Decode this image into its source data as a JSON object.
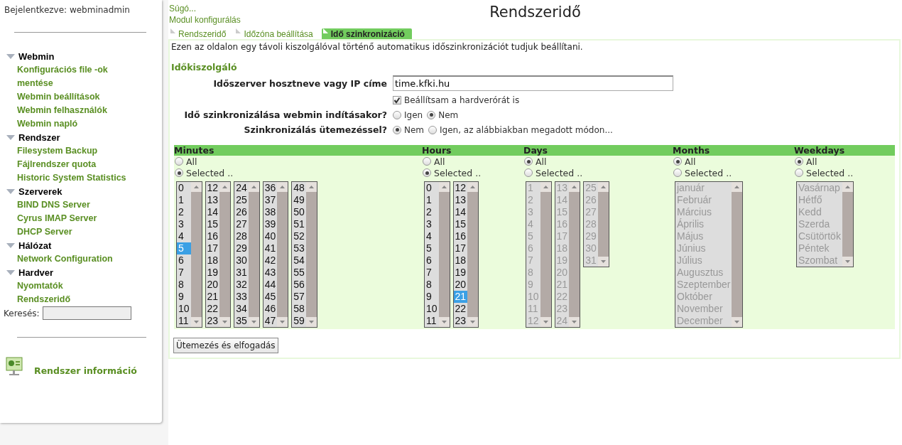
{
  "sidebar": {
    "login": "Bejelentkezve: webminadmin",
    "sections": [
      {
        "title": "Webmin",
        "expanded": true,
        "items": [
          "Konfigurációs file -ok mentése",
          "Webmin beállítások",
          "Webmin felhasználók",
          "Webmin napló"
        ]
      },
      {
        "title": "Rendszer",
        "expanded": true,
        "items": [
          "Filesystem Backup",
          "Fájlrendszer quota",
          "Historic System Statistics"
        ]
      },
      {
        "title": "Szerverek",
        "expanded": true,
        "items": [
          "BIND DNS Server",
          "Cyrus IMAP Server",
          "DHCP Server"
        ]
      },
      {
        "title": "Hálózat",
        "expanded": true,
        "items": [
          "Network Configuration"
        ]
      },
      {
        "title": "Hardver",
        "expanded": true,
        "items": [
          "Nyomtatók",
          "Rendszeridő"
        ]
      }
    ],
    "search_label": "Keresés:",
    "info_link": "Rendszer információ"
  },
  "links": [
    "Súgó...",
    "Modul konfigurálás"
  ],
  "title": "Rendszeridő",
  "tabs": [
    {
      "label": "Rendszeridő",
      "selected": false
    },
    {
      "label": "Időzóna beállítása",
      "selected": false
    },
    {
      "label": "Idő szinkronizáció",
      "selected": true
    }
  ],
  "description": "Ezen az oldalon egy távoli kiszolgálóval történő automatikus időszinkronizációt tudjuk beállítani.",
  "section_title": "Időkiszolgáló",
  "form": [
    {
      "kind": "text",
      "label": "Időszerver hosztneve vagy IP címe",
      "value": "time.kfki.hu"
    },
    {
      "kind": "checkbox",
      "option": "Beállítsam a hardverórát is",
      "checked": true
    },
    {
      "kind": "radio",
      "label": "Idő szinkronizálása webmin indításakor?",
      "options": [
        {
          "label": "Igen",
          "selected": false
        },
        {
          "label": "Nem",
          "selected": true
        }
      ]
    },
    {
      "kind": "radio",
      "label": "Szinkronizálás ütemezéssel?",
      "options": [
        {
          "label": "Nem",
          "selected": true
        },
        {
          "label": "Igen, az alábbiakban megadott módon...",
          "selected": false
        }
      ]
    }
  ],
  "schedule": {
    "columns": [
      {
        "title": "Minutes",
        "options": [
          {
            "label": "All",
            "selected": false
          },
          {
            "label": "Selected ..",
            "selected": true
          }
        ],
        "lists": [
          {
            "disabled": false,
            "items": [
              {
                "label": "0",
                "selected": false
              },
              {
                "label": "1",
                "selected": false
              },
              {
                "label": "2",
                "selected": false
              },
              {
                "label": "3",
                "selected": false
              },
              {
                "label": "4",
                "selected": false
              },
              {
                "label": "5",
                "selected": true
              },
              {
                "label": "6",
                "selected": false
              },
              {
                "label": "7",
                "selected": false
              },
              {
                "label": "8",
                "selected": false
              },
              {
                "label": "9",
                "selected": false
              },
              {
                "label": "10",
                "selected": false
              },
              {
                "label": "11",
                "selected": false
              }
            ]
          },
          {
            "disabled": false,
            "items": [
              {
                "label": "12",
                "selected": false
              },
              {
                "label": "13",
                "selected": false
              },
              {
                "label": "14",
                "selected": false
              },
              {
                "label": "15",
                "selected": false
              },
              {
                "label": "16",
                "selected": false
              },
              {
                "label": "17",
                "selected": false
              },
              {
                "label": "18",
                "selected": false
              },
              {
                "label": "19",
                "selected": false
              },
              {
                "label": "20",
                "selected": false
              },
              {
                "label": "21",
                "selected": false
              },
              {
                "label": "22",
                "selected": false
              },
              {
                "label": "23",
                "selected": false
              }
            ]
          },
          {
            "disabled": false,
            "items": [
              {
                "label": "24",
                "selected": false
              },
              {
                "label": "25",
                "selected": false
              },
              {
                "label": "26",
                "selected": false
              },
              {
                "label": "27",
                "selected": false
              },
              {
                "label": "28",
                "selected": false
              },
              {
                "label": "29",
                "selected": false
              },
              {
                "label": "30",
                "selected": false
              },
              {
                "label": "31",
                "selected": false
              },
              {
                "label": "32",
                "selected": false
              },
              {
                "label": "33",
                "selected": false
              },
              {
                "label": "34",
                "selected": false
              },
              {
                "label": "35",
                "selected": false
              }
            ]
          },
          {
            "disabled": false,
            "items": [
              {
                "label": "36",
                "selected": false
              },
              {
                "label": "37",
                "selected": false
              },
              {
                "label": "38",
                "selected": false
              },
              {
                "label": "39",
                "selected": false
              },
              {
                "label": "40",
                "selected": false
              },
              {
                "label": "41",
                "selected": false
              },
              {
                "label": "42",
                "selected": false
              },
              {
                "label": "43",
                "selected": false
              },
              {
                "label": "44",
                "selected": false
              },
              {
                "label": "45",
                "selected": false
              },
              {
                "label": "46",
                "selected": false
              },
              {
                "label": "47",
                "selected": false
              }
            ]
          },
          {
            "disabled": false,
            "items": [
              {
                "label": "48",
                "selected": false
              },
              {
                "label": "49",
                "selected": false
              },
              {
                "label": "50",
                "selected": false
              },
              {
                "label": "51",
                "selected": false
              },
              {
                "label": "52",
                "selected": false
              },
              {
                "label": "53",
                "selected": false
              },
              {
                "label": "54",
                "selected": false
              },
              {
                "label": "55",
                "selected": false
              },
              {
                "label": "56",
                "selected": false
              },
              {
                "label": "57",
                "selected": false
              },
              {
                "label": "58",
                "selected": false
              },
              {
                "label": "59",
                "selected": false
              }
            ]
          }
        ]
      },
      {
        "title": "Hours",
        "options": [
          {
            "label": "All",
            "selected": false
          },
          {
            "label": "Selected ..",
            "selected": true
          }
        ],
        "lists": [
          {
            "disabled": false,
            "items": [
              {
                "label": "0",
                "selected": false
              },
              {
                "label": "1",
                "selected": false
              },
              {
                "label": "2",
                "selected": false
              },
              {
                "label": "3",
                "selected": false
              },
              {
                "label": "4",
                "selected": false
              },
              {
                "label": "5",
                "selected": false
              },
              {
                "label": "6",
                "selected": false
              },
              {
                "label": "7",
                "selected": false
              },
              {
                "label": "8",
                "selected": false
              },
              {
                "label": "9",
                "selected": false
              },
              {
                "label": "10",
                "selected": false
              },
              {
                "label": "11",
                "selected": false
              }
            ]
          },
          {
            "disabled": false,
            "items": [
              {
                "label": "12",
                "selected": false
              },
              {
                "label": "13",
                "selected": false
              },
              {
                "label": "14",
                "selected": false
              },
              {
                "label": "15",
                "selected": false
              },
              {
                "label": "16",
                "selected": false
              },
              {
                "label": "17",
                "selected": false
              },
              {
                "label": "18",
                "selected": false
              },
              {
                "label": "19",
                "selected": false
              },
              {
                "label": "20",
                "selected": false
              },
              {
                "label": "21",
                "selected": true
              },
              {
                "label": "22",
                "selected": false
              },
              {
                "label": "23",
                "selected": false
              }
            ]
          }
        ]
      },
      {
        "title": "Days",
        "options": [
          {
            "label": "All",
            "selected": true
          },
          {
            "label": "Selected ..",
            "selected": false
          }
        ],
        "lists": [
          {
            "disabled": true,
            "items": [
              {
                "label": "1",
                "selected": false
              },
              {
                "label": "2",
                "selected": false
              },
              {
                "label": "3",
                "selected": false
              },
              {
                "label": "4",
                "selected": false
              },
              {
                "label": "5",
                "selected": false
              },
              {
                "label": "6",
                "selected": false
              },
              {
                "label": "7",
                "selected": false
              },
              {
                "label": "8",
                "selected": false
              },
              {
                "label": "9",
                "selected": false
              },
              {
                "label": "10",
                "selected": false
              },
              {
                "label": "11",
                "selected": false
              },
              {
                "label": "12",
                "selected": false
              }
            ]
          },
          {
            "disabled": true,
            "items": [
              {
                "label": "13",
                "selected": false
              },
              {
                "label": "14",
                "selected": false
              },
              {
                "label": "15",
                "selected": false
              },
              {
                "label": "16",
                "selected": false
              },
              {
                "label": "17",
                "selected": false
              },
              {
                "label": "18",
                "selected": false
              },
              {
                "label": "19",
                "selected": false
              },
              {
                "label": "20",
                "selected": false
              },
              {
                "label": "21",
                "selected": false
              },
              {
                "label": "22",
                "selected": false
              },
              {
                "label": "23",
                "selected": false
              },
              {
                "label": "24",
                "selected": false
              }
            ]
          },
          {
            "disabled": true,
            "items": [
              {
                "label": "25",
                "selected": false
              },
              {
                "label": "26",
                "selected": false
              },
              {
                "label": "27",
                "selected": false
              },
              {
                "label": "28",
                "selected": false
              },
              {
                "label": "29",
                "selected": false
              },
              {
                "label": "30",
                "selected": false
              },
              {
                "label": "31",
                "selected": false
              }
            ]
          }
        ]
      },
      {
        "title": "Months",
        "options": [
          {
            "label": "All",
            "selected": true
          },
          {
            "label": "Selected ..",
            "selected": false
          }
        ],
        "lists": [
          {
            "disabled": true,
            "items": [
              {
                "label": "január",
                "selected": false
              },
              {
                "label": "Február",
                "selected": false
              },
              {
                "label": "Március",
                "selected": false
              },
              {
                "label": "Április",
                "selected": false
              },
              {
                "label": "Május",
                "selected": false
              },
              {
                "label": "Június",
                "selected": false
              },
              {
                "label": "Július",
                "selected": false
              },
              {
                "label": "Augusztus",
                "selected": false
              },
              {
                "label": "Szeptember",
                "selected": false
              },
              {
                "label": "Október",
                "selected": false
              },
              {
                "label": "November",
                "selected": false
              },
              {
                "label": "December",
                "selected": false
              }
            ]
          }
        ]
      },
      {
        "title": "Weekdays",
        "options": [
          {
            "label": "All",
            "selected": true
          },
          {
            "label": "Selected ..",
            "selected": false
          }
        ],
        "lists": [
          {
            "disabled": true,
            "items": [
              {
                "label": "Vasárnap",
                "selected": false
              },
              {
                "label": "Hétfő",
                "selected": false
              },
              {
                "label": "Kedd",
                "selected": false
              },
              {
                "label": "Szerda",
                "selected": false
              },
              {
                "label": "Csütörtök",
                "selected": false
              },
              {
                "label": "Péntek",
                "selected": false
              },
              {
                "label": "Szombat",
                "selected": false
              }
            ]
          }
        ]
      }
    ]
  },
  "submit": "Ütemezés és elfogadás"
}
